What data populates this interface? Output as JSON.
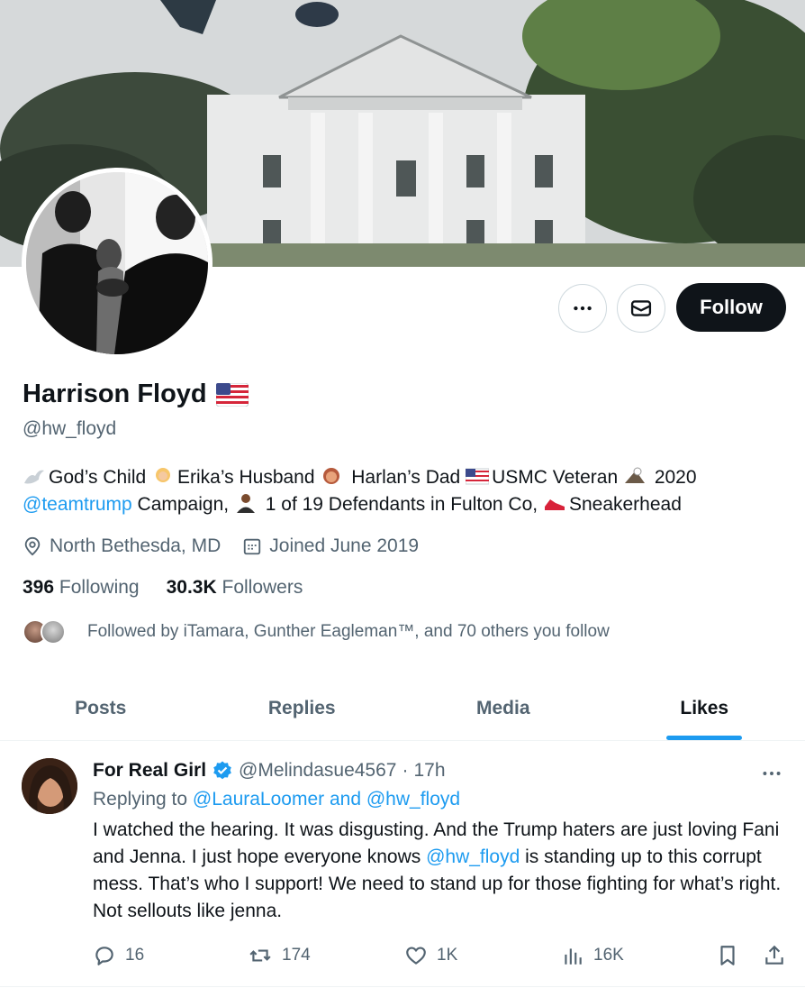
{
  "profile": {
    "display_name": "Harrison Floyd",
    "flag_emoji": "🇺🇸",
    "handle": "@hw_floyd",
    "bio": {
      "line1": [
        {
          "emoji": "dove",
          "text": "God’s Child "
        },
        {
          "emoji": "bride",
          "text": "Erika’s Husband "
        },
        {
          "emoji": "child",
          "text": " Harlan’s Dad "
        },
        {
          "emoji": "flag",
          "text": "USMC Veteran "
        },
        {
          "emoji": "eagle",
          "text": " 2020"
        }
      ],
      "link": "@teamtrump",
      "line2_after_link": " Campaign, ",
      "line2_segments": [
        {
          "emoji": "person",
          "text": " 1 of 19 Defendants in Fulton Co, "
        },
        {
          "emoji": "shoe",
          "text": "Sneakerhead"
        }
      ]
    },
    "location": "North Bethesda, MD",
    "joined": "Joined June 2019",
    "following_count": "396",
    "following_label": "Following",
    "followers_count": "30.3K",
    "followers_label": "Followers",
    "followed_by": "Followed by iTamara, Gunther Eagleman™, and 70 others you follow"
  },
  "actions": {
    "more_icon": "more-horizontal-icon",
    "message_icon": "envelope-icon",
    "follow_label": "Follow"
  },
  "tabs": [
    {
      "label": "Posts",
      "active": false
    },
    {
      "label": "Replies",
      "active": false
    },
    {
      "label": "Media",
      "active": false
    },
    {
      "label": "Likes",
      "active": true
    }
  ],
  "tweet": {
    "author_name": "For Real Girl",
    "author_handle": "@Melindasue4567",
    "separator": "·",
    "time": "17h",
    "replying_prefix": "Replying to ",
    "replying_to_1": "@LauraLoomer",
    "replying_and": " and ",
    "replying_to_2": "@hw_floyd",
    "body_part1": "I watched the hearing. It was disgusting. And the Trump haters are just loving Fani and Jenna. I just hope everyone knows ",
    "body_mention": "@hw_floyd",
    "body_part2": " is standing up to this corrupt mess. That’s who I support! We need to stand up for those fighting for what’s right. Not sellouts like jenna.",
    "replies": "16",
    "reposts": "174",
    "likes": "1K",
    "views": "16K"
  },
  "colors": {
    "accent": "#1d9bf0",
    "text_primary": "#0f1419",
    "text_secondary": "#536471",
    "follow_bg": "#0f1419",
    "border": "#eff3f4",
    "verified": "#1d9bf0"
  }
}
